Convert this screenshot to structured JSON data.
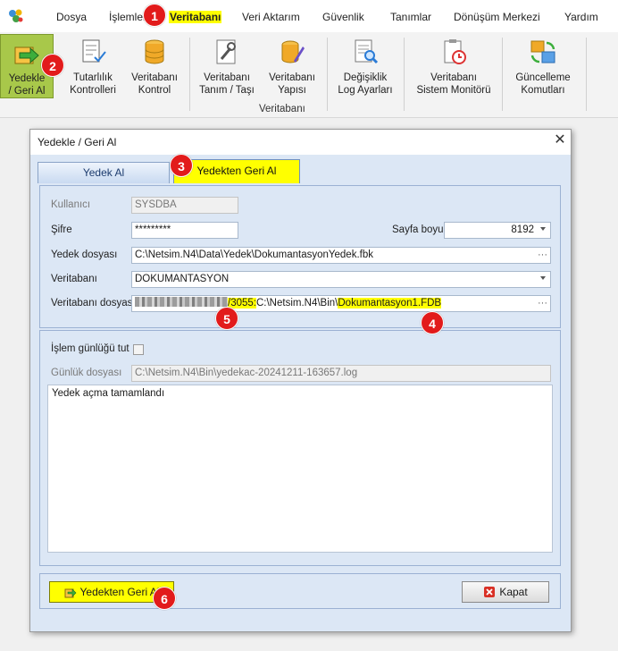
{
  "menu": {
    "items": [
      "Dosya",
      "İşlemler",
      "Veritabanı",
      "Veri Aktarım",
      "Güvenlik",
      "Tanımlar",
      "Dönüşüm Merkezi",
      "Yardım"
    ]
  },
  "ribbon": {
    "buttons": [
      {
        "line1": "Yedekle",
        "line2": "/ Geri Al"
      },
      {
        "line1": "Tutarlılık",
        "line2": "Kontrolleri"
      },
      {
        "line1": "Veritabanı",
        "line2": "Kontrol"
      },
      {
        "line1": "Veritabanı",
        "line2": "Tanım / Taşı"
      },
      {
        "line1": "Veritabanı",
        "line2": "Yapısı"
      },
      {
        "line1": "Değişiklik",
        "line2": "Log Ayarları"
      },
      {
        "line1": "Veritabanı",
        "line2": "Sistem Monitörü"
      },
      {
        "line1": "Güncelleme",
        "line2": "Komutları"
      }
    ],
    "group_label": "Veritabanı"
  },
  "badges": [
    "1",
    "2",
    "3",
    "4",
    "5",
    "6"
  ],
  "dialog": {
    "title": "Yedekle / Geri Al",
    "tabs": [
      "Yedek Al",
      "Yedekten Geri Al"
    ],
    "fields": {
      "user_label": "Kullanıcı",
      "user_value": "SYSDBA",
      "password_label": "Şifre",
      "password_value": "*********",
      "page_size_label": "Sayfa boyu",
      "page_size_value": "8192",
      "backup_file_label": "Yedek dosyası",
      "backup_file_value": "C:\\Netsim.N4\\Data\\Yedek\\DokumantasyonYedek.fbk",
      "database_label": "Veritabanı",
      "database_value": "DOKUMANTASYON",
      "db_file_label": "Veritabanı dosyası",
      "db_file_port": "/3055:",
      "db_file_path": "C:\\Netsim.N4\\Bin\\",
      "db_file_name": "Dokumantasyon1.FDB"
    },
    "log": {
      "keep_log_label": "İşlem günlüğü tut",
      "log_file_label": "Günlük dosyası",
      "log_file_value": "C:\\Netsim.N4\\Bin\\yedekac-20241211-163657.log",
      "message": "Yedek açma tamamlandı"
    },
    "buttons": {
      "restore": "Yedekten Geri Al",
      "close": "Kapat"
    }
  },
  "colors": {
    "highlight": "#ffff00",
    "badge": "#e21b1b",
    "dialog_body": "#dce7f5",
    "ribbon_active": "#a8c84a"
  }
}
